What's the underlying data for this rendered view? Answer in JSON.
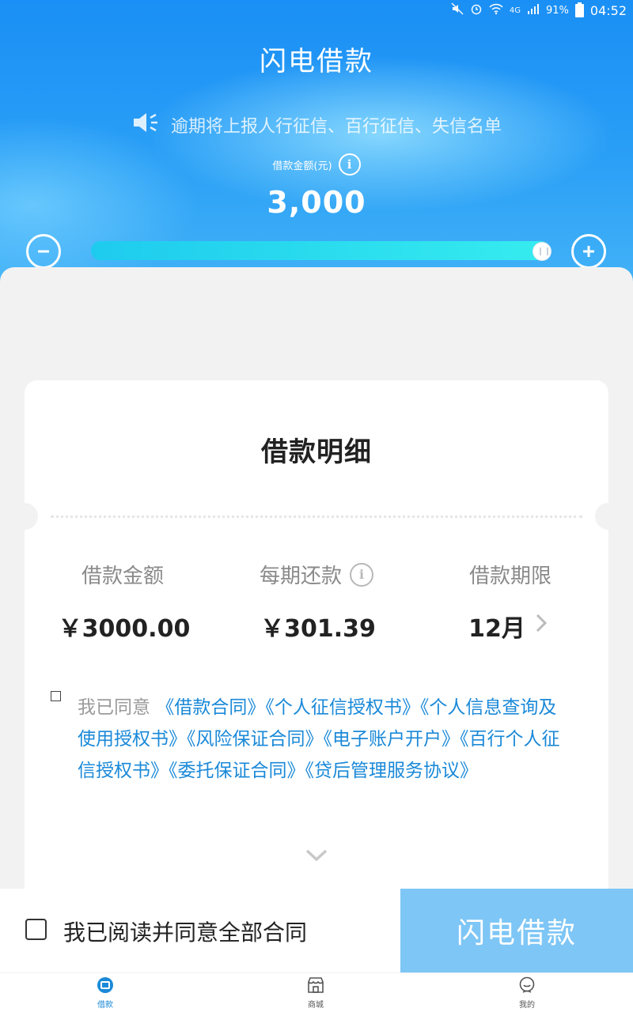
{
  "status_bar": {
    "battery": "91%",
    "network": "4G",
    "time": "04:52"
  },
  "header": {
    "title": "闪电借款",
    "notice": "逾期将上报人行征信、百行征信、失信名单",
    "amount_label": "借款金额(元)",
    "amount_value": "3,000",
    "slider_level": 1.0
  },
  "detail": {
    "title": "借款明细",
    "columns": [
      {
        "label": "借款金额",
        "value": "￥3000.00"
      },
      {
        "label": "每期还款",
        "value": "￥301.39"
      },
      {
        "label": "借款期限",
        "value": "12月"
      }
    ],
    "agreement": {
      "prefix": "我已同意",
      "links": [
        "《借款合同》",
        "《个人征信授权书》",
        "《个人信息查询及使用授权书》",
        "《风险保证合同》",
        "《电子账户开户》",
        "《百行个人征信授权书》",
        "《委托保证合同》",
        "《贷后管理服务协议》"
      ]
    }
  },
  "bottom": {
    "agree_all": "我已阅读并同意全部合同",
    "submit": "闪电借款"
  },
  "tabs": [
    {
      "label": "借款",
      "icon": "loan-icon",
      "active": true
    },
    {
      "label": "商城",
      "icon": "shop-icon",
      "active": false
    },
    {
      "label": "我的",
      "icon": "profile-icon",
      "active": false
    }
  ],
  "colors": {
    "primary": "#1a89d8",
    "header": "#2a9ff6",
    "submit_disabled": "#7ec6f6"
  }
}
